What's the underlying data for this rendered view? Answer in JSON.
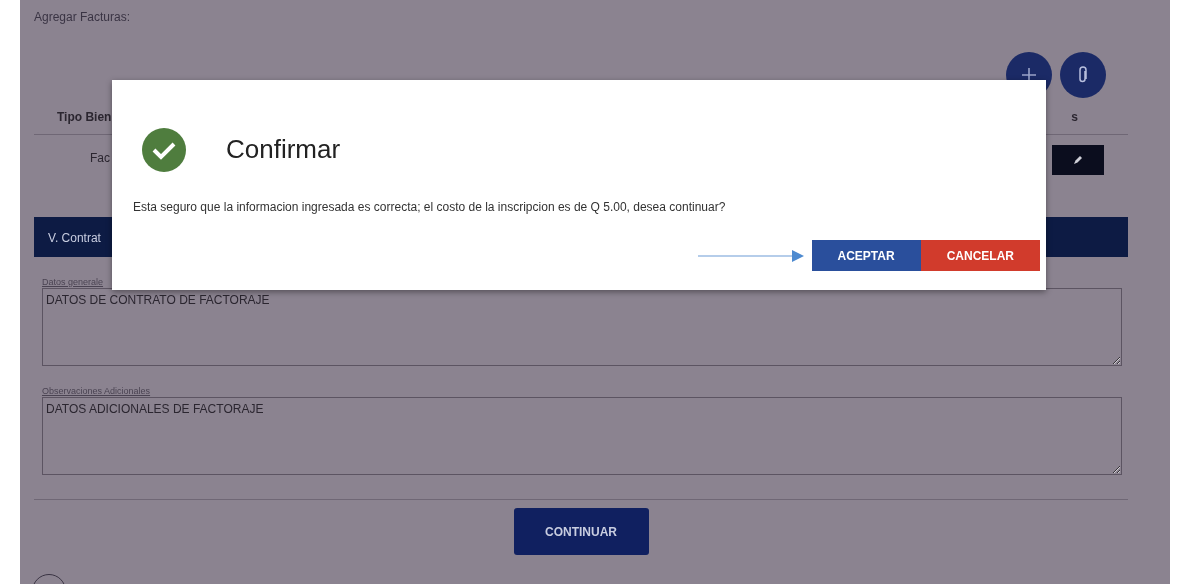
{
  "page": {
    "title": "Agregar Facturas:",
    "table": {
      "columns": [
        "Tipo Bien",
        "s"
      ],
      "rows": [
        {
          "cells": [
            "Fac"
          ]
        }
      ]
    },
    "section": {
      "title": "V. Contrat"
    },
    "fields": [
      {
        "label": "Datos generale",
        "value": "DATOS DE CONTRATO DE FACTORAJE"
      },
      {
        "label": "Observaciones Adicionales",
        "value": "DATOS ADICIONALES DE FACTORAJE"
      }
    ],
    "continue_button": "CONTINUAR"
  },
  "dialog": {
    "title": "Confirmar",
    "message": "Esta seguro que la informacion ingresada es correcta; el costo de la inscripcion es de Q 5.00, desea continuar?",
    "buttons": [
      {
        "label": "ACEPTAR",
        "kind": "primary"
      },
      {
        "label": "CANCELAR",
        "kind": "danger"
      }
    ]
  }
}
